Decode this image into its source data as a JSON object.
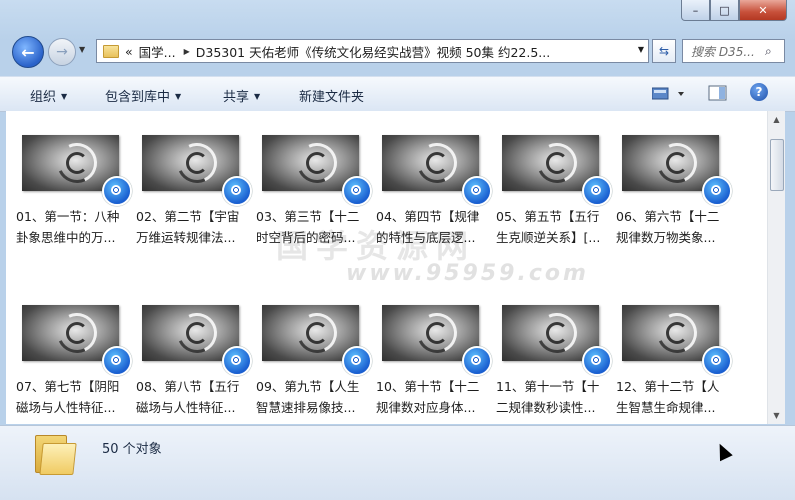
{
  "window": {
    "minimize_glyph": "–",
    "maximize_glyph": "□",
    "close_glyph": "✕"
  },
  "nav": {
    "back_glyph": "←",
    "forward_glyph": "→",
    "recent_glyph": "▼"
  },
  "address": {
    "overflow_glyph": "«",
    "crumbs": [
      "国学...",
      "D35301 天佑老师《传统文化易经实战营》视频 50集 约22.5..."
    ],
    "separator_glyph": "▶",
    "dropdown_glyph": "▼",
    "refresh_glyph": "⇆"
  },
  "search": {
    "placeholder": "搜索 D35...",
    "icon": "search-icon",
    "icon_glyph": "⌕"
  },
  "toolbar": {
    "organize": "组织",
    "include_in_library": "包含到库中",
    "share": "共享",
    "new_folder": "新建文件夹",
    "caret_glyph": "▼",
    "help_glyph": "?"
  },
  "files": [
    {
      "line1": "01、第一节：八种",
      "line2": "卦象思维中的万..."
    },
    {
      "line1": "02、第二节【宇宙",
      "line2": "万维运转规律法..."
    },
    {
      "line1": "03、第三节【十二",
      "line2": "时空背后的密码..."
    },
    {
      "line1": "04、第四节【规律",
      "line2": "的特性与底层逻..."
    },
    {
      "line1": "05、第五节【五行",
      "line2": "生克顺逆关系】[..."
    },
    {
      "line1": "06、第六节【十二",
      "line2": "规律数万物类象..."
    },
    {
      "line1": "07、第七节【阴阳",
      "line2": "磁场与人性特征..."
    },
    {
      "line1": "08、第八节【五行",
      "line2": "磁场与人性特征..."
    },
    {
      "line1": "09、第九节【人生",
      "line2": "智慧速排易像技..."
    },
    {
      "line1": "10、第十节【十二",
      "line2": "规律数对应身体..."
    },
    {
      "line1": "11、第十一节【十",
      "line2": "二规律数秒读性..."
    },
    {
      "line1": "12、第十二节【人",
      "line2": "生智慧生命规律..."
    }
  ],
  "watermark": {
    "text1": "国学资源网",
    "text2": "www.95959.com"
  },
  "scrollbar": {
    "up_glyph": "▲",
    "down_glyph": "▼"
  },
  "status": {
    "count_text": "50 个对象"
  }
}
